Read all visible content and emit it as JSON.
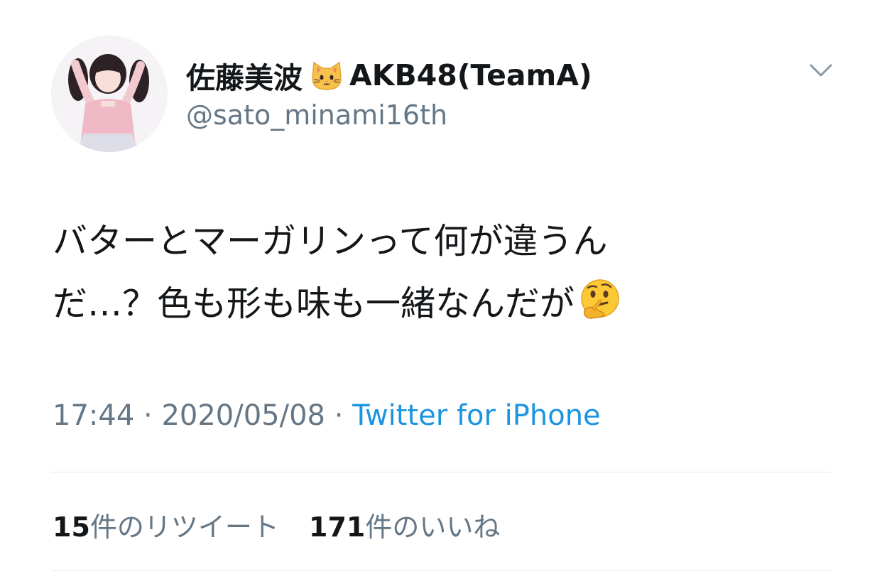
{
  "user": {
    "display_name": "佐藤美波",
    "name_emoji": "cat-face-emoji",
    "team": "AKB48(TeamA)",
    "handle": "@sato_minami16th"
  },
  "tweet": {
    "line1": "バターとマーガリンって何が違うん",
    "line2": "だ…？色も形も味も一緒なんだが",
    "trailing_emoji": "thinking-face-emoji"
  },
  "meta": {
    "time": "17:44",
    "separator1": " · ",
    "date": "2020/05/08",
    "separator2": " · ",
    "source": "Twitter for iPhone"
  },
  "stats": {
    "retweets_count": "15",
    "retweets_label": "件のリツイート",
    "likes_count": "171",
    "likes_label": "件のいいね"
  },
  "colors": {
    "text": "#14171a",
    "secondary": "#657786",
    "link": "#1b95e0",
    "divider": "#e1e8ed"
  }
}
